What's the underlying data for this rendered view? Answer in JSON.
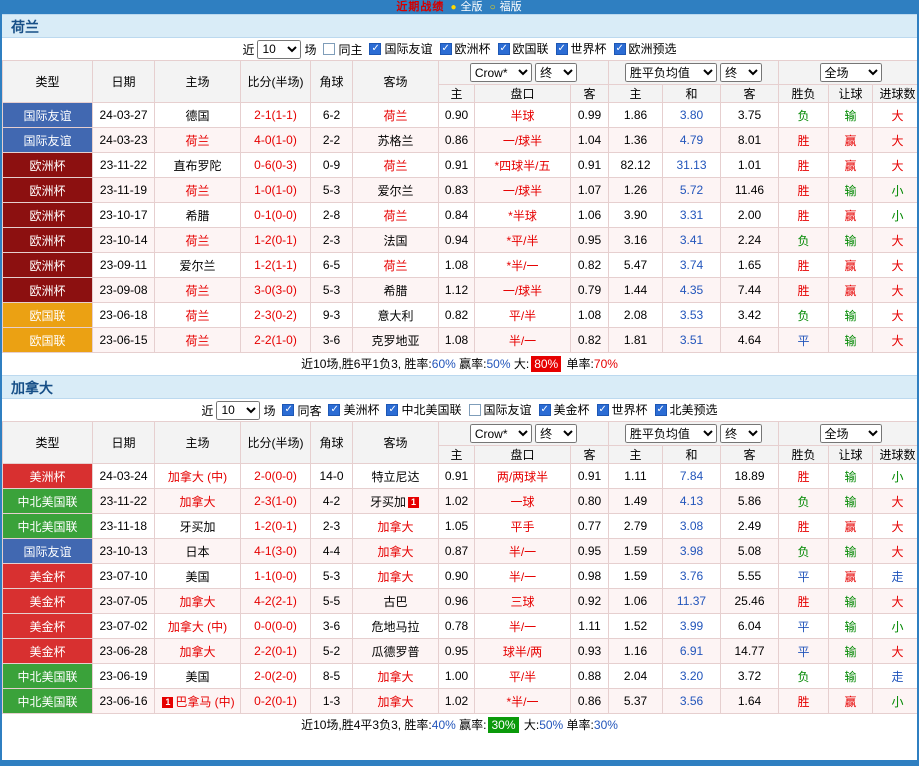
{
  "topbar": {
    "title": "近期战绩",
    "radio_on": "●",
    "tab_full": "全版",
    "radio_off": "○",
    "tab_fu": "福版"
  },
  "value_colors": {
    "胜": "#e60000",
    "平": "#2255bb",
    "负": "#008800",
    "赢": "#e60000",
    "输": "#008800",
    "大": "#e60000",
    "小": "#008800",
    "走": "#2255bb"
  },
  "league_colors": {
    "国际友谊": "#4168b1",
    "欧洲杯": "#8c1010",
    "欧国联": "#eba113",
    "美洲杯": "#d83030",
    "中北美国联": "#3aa23a",
    "美金杯": "#d83030"
  },
  "sections": [
    {
      "team": "荷兰",
      "filter": {
        "near": "近",
        "count": "10",
        "games": "场",
        "same": {
          "label": "同主",
          "checked": false
        },
        "leagues": [
          {
            "label": "国际友谊",
            "checked": true
          },
          {
            "label": "欧洲杯",
            "checked": true
          },
          {
            "label": "欧国联",
            "checked": true
          },
          {
            "label": "世界杯",
            "checked": true
          },
          {
            "label": "欧洲预选",
            "checked": true
          }
        ]
      },
      "columns": {
        "type": "类型",
        "date": "日期",
        "home": "主场",
        "score": "比分(半场)",
        "corner": "角球",
        "away": "客场",
        "odds_source": "Crow*",
        "final1": "终",
        "avg": "胜平负均值",
        "final2": "终",
        "scope": "全场",
        "sub_home": "主",
        "sub_handicap": "盘口",
        "sub_away": "客",
        "sub_avg_home": "主",
        "sub_avg_draw": "和",
        "sub_avg_away": "客",
        "sub_result": "胜负",
        "sub_let": "让球",
        "sub_goals": "进球数"
      },
      "rows": [
        {
          "league": "国际友谊",
          "date": "24-03-27",
          "home": "德国",
          "home_red": false,
          "score": "2-1(1-1)",
          "corner": "6-2",
          "away": "荷兰",
          "away_red": true,
          "odds_home": "0.90",
          "handicap": "半球",
          "odds_away": "0.99",
          "avg_home": "1.86",
          "avg_draw": "3.80",
          "avg_away": "3.75",
          "result": "负",
          "let_result": "输",
          "goals_result": "大"
        },
        {
          "league": "国际友谊",
          "date": "24-03-23",
          "home": "荷兰",
          "home_red": true,
          "score": "4-0(1-0)",
          "corner": "2-2",
          "away": "苏格兰",
          "away_red": false,
          "odds_home": "0.86",
          "handicap": "一/球半",
          "odds_away": "1.04",
          "avg_home": "1.36",
          "avg_draw": "4.79",
          "avg_away": "8.01",
          "result": "胜",
          "let_result": "赢",
          "goals_result": "大"
        },
        {
          "league": "欧洲杯",
          "date": "23-11-22",
          "home": "直布罗陀",
          "home_red": false,
          "score": "0-6(0-3)",
          "corner": "0-9",
          "away": "荷兰",
          "away_red": true,
          "odds_home": "0.91",
          "handicap": "*四球半/五",
          "odds_away": "0.91",
          "avg_home": "82.12",
          "avg_draw": "31.13",
          "avg_away": "1.01",
          "result": "胜",
          "let_result": "赢",
          "goals_result": "大"
        },
        {
          "league": "欧洲杯",
          "date": "23-11-19",
          "home": "荷兰",
          "home_red": true,
          "score": "1-0(1-0)",
          "corner": "5-3",
          "away": "爱尔兰",
          "away_red": false,
          "odds_home": "0.83",
          "handicap": "一/球半",
          "odds_away": "1.07",
          "avg_home": "1.26",
          "avg_draw": "5.72",
          "avg_away": "11.46",
          "result": "胜",
          "let_result": "输",
          "goals_result": "小"
        },
        {
          "league": "欧洲杯",
          "date": "23-10-17",
          "home": "希腊",
          "home_red": false,
          "score": "0-1(0-0)",
          "corner": "2-8",
          "away": "荷兰",
          "away_red": true,
          "odds_home": "0.84",
          "handicap": "*半球",
          "odds_away": "1.06",
          "avg_home": "3.90",
          "avg_draw": "3.31",
          "avg_away": "2.00",
          "result": "胜",
          "let_result": "赢",
          "goals_result": "小"
        },
        {
          "league": "欧洲杯",
          "date": "23-10-14",
          "home": "荷兰",
          "home_red": true,
          "score": "1-2(0-1)",
          "corner": "2-3",
          "away": "法国",
          "away_red": false,
          "odds_home": "0.94",
          "handicap": "*平/半",
          "odds_away": "0.95",
          "avg_home": "3.16",
          "avg_draw": "3.41",
          "avg_away": "2.24",
          "result": "负",
          "let_result": "输",
          "goals_result": "大"
        },
        {
          "league": "欧洲杯",
          "date": "23-09-11",
          "home": "爱尔兰",
          "home_red": false,
          "score": "1-2(1-1)",
          "corner": "6-5",
          "away": "荷兰",
          "away_red": true,
          "odds_home": "1.08",
          "handicap": "*半/一",
          "odds_away": "0.82",
          "avg_home": "5.47",
          "avg_draw": "3.74",
          "avg_away": "1.65",
          "result": "胜",
          "let_result": "赢",
          "goals_result": "大"
        },
        {
          "league": "欧洲杯",
          "date": "23-09-08",
          "home": "荷兰",
          "home_red": true,
          "score": "3-0(3-0)",
          "corner": "5-3",
          "away": "希腊",
          "away_red": false,
          "odds_home": "1.12",
          "handicap": "一/球半",
          "odds_away": "0.79",
          "avg_home": "1.44",
          "avg_draw": "4.35",
          "avg_away": "7.44",
          "result": "胜",
          "let_result": "赢",
          "goals_result": "大"
        },
        {
          "league": "欧国联",
          "date": "23-06-18",
          "home": "荷兰",
          "home_red": true,
          "score": "2-3(0-2)",
          "corner": "9-3",
          "away": "意大利",
          "away_red": false,
          "odds_home": "0.82",
          "handicap": "平/半",
          "odds_away": "1.08",
          "avg_home": "2.08",
          "avg_draw": "3.53",
          "avg_away": "3.42",
          "result": "负",
          "let_result": "输",
          "goals_result": "大"
        },
        {
          "league": "欧国联",
          "date": "23-06-15",
          "home": "荷兰",
          "home_red": true,
          "score": "2-2(1-0)",
          "corner": "3-6",
          "away": "克罗地亚",
          "away_red": false,
          "odds_home": "1.08",
          "handicap": "半/一",
          "odds_away": "0.82",
          "avg_home": "1.81",
          "avg_draw": "3.51",
          "avg_away": "4.64",
          "result": "平",
          "let_result": "输",
          "goals_result": "大"
        }
      ],
      "summary": [
        {
          "text": "近10场,胜6平1负3, 胜率:",
          "style": "plain"
        },
        {
          "text": "60%",
          "style": "blue"
        },
        {
          "text": " 赢率:",
          "style": "plain"
        },
        {
          "text": "50%",
          "style": "blue"
        },
        {
          "text": " 大:",
          "style": "plain"
        },
        {
          "text": "80%",
          "style": "red-badge"
        },
        {
          "text": " 单率:",
          "style": "plain"
        },
        {
          "text": "70%",
          "style": "red"
        }
      ]
    },
    {
      "team": "加拿大",
      "filter": {
        "near": "近",
        "count": "10",
        "games": "场",
        "same": {
          "label": "同客",
          "checked": true
        },
        "leagues": [
          {
            "label": "美洲杯",
            "checked": true
          },
          {
            "label": "中北美国联",
            "checked": true
          },
          {
            "label": "国际友谊",
            "checked": false
          },
          {
            "label": "美金杯",
            "checked": true
          },
          {
            "label": "世界杯",
            "checked": true
          },
          {
            "label": "北美预选",
            "checked": true
          }
        ]
      },
      "columns": {
        "type": "类型",
        "date": "日期",
        "home": "主场",
        "score": "比分(半场)",
        "corner": "角球",
        "away": "客场",
        "odds_source": "Crow*",
        "final1": "终",
        "avg": "胜平负均值",
        "final2": "终",
        "scope": "全场",
        "sub_home": "主",
        "sub_handicap": "盘口",
        "sub_away": "客",
        "sub_avg_home": "主",
        "sub_avg_draw": "和",
        "sub_avg_away": "客",
        "sub_result": "胜负",
        "sub_let": "让球",
        "sub_goals": "进球数"
      },
      "rows": [
        {
          "league": "美洲杯",
          "date": "24-03-24",
          "home": "加拿大 (中)",
          "home_red": true,
          "score": "2-0(0-0)",
          "corner": "14-0",
          "away": "特立尼达",
          "away_red": false,
          "odds_home": "0.91",
          "handicap": "两/两球半",
          "odds_away": "0.91",
          "avg_home": "1.11",
          "avg_draw": "7.84",
          "avg_away": "18.89",
          "result": "胜",
          "let_result": "输",
          "goals_result": "小"
        },
        {
          "league": "中北美国联",
          "date": "23-11-22",
          "home": "加拿大",
          "home_red": true,
          "score": "2-3(1-0)",
          "corner": "4-2",
          "away": "牙买加",
          "away_red": false,
          "away_badge": "1",
          "odds_home": "1.02",
          "handicap": "一球",
          "odds_away": "0.80",
          "avg_home": "1.49",
          "avg_draw": "4.13",
          "avg_away": "5.86",
          "result": "负",
          "let_result": "输",
          "goals_result": "大"
        },
        {
          "league": "中北美国联",
          "date": "23-11-18",
          "home": "牙买加",
          "home_red": false,
          "score": "1-2(0-1)",
          "corner": "2-3",
          "away": "加拿大",
          "away_red": true,
          "odds_home": "1.05",
          "handicap": "平手",
          "odds_away": "0.77",
          "avg_home": "2.79",
          "avg_draw": "3.08",
          "avg_away": "2.49",
          "result": "胜",
          "let_result": "赢",
          "goals_result": "大"
        },
        {
          "league": "国际友谊",
          "date": "23-10-13",
          "home": "日本",
          "home_red": false,
          "score": "4-1(3-0)",
          "corner": "4-4",
          "away": "加拿大",
          "away_red": true,
          "odds_home": "0.87",
          "handicap": "半/一",
          "odds_away": "0.95",
          "avg_home": "1.59",
          "avg_draw": "3.98",
          "avg_away": "5.08",
          "result": "负",
          "let_result": "输",
          "goals_result": "大"
        },
        {
          "league": "美金杯",
          "date": "23-07-10",
          "home": "美国",
          "home_red": false,
          "score": "1-1(0-0)",
          "corner": "5-3",
          "away": "加拿大",
          "away_red": true,
          "odds_home": "0.90",
          "handicap": "半/一",
          "odds_away": "0.98",
          "avg_home": "1.59",
          "avg_draw": "3.76",
          "avg_away": "5.55",
          "result": "平",
          "let_result": "赢",
          "goals_result": "走"
        },
        {
          "league": "美金杯",
          "date": "23-07-05",
          "home": "加拿大",
          "home_red": true,
          "score": "4-2(2-1)",
          "corner": "5-5",
          "away": "古巴",
          "away_red": false,
          "odds_home": "0.96",
          "handicap": "三球",
          "odds_away": "0.92",
          "avg_home": "1.06",
          "avg_draw": "11.37",
          "avg_away": "25.46",
          "result": "胜",
          "let_result": "输",
          "goals_result": "大"
        },
        {
          "league": "美金杯",
          "date": "23-07-02",
          "home": "加拿大 (中)",
          "home_red": true,
          "score": "0-0(0-0)",
          "corner": "3-6",
          "away": "危地马拉",
          "away_red": false,
          "odds_home": "0.78",
          "handicap": "半/一",
          "odds_away": "1.11",
          "avg_home": "1.52",
          "avg_draw": "3.99",
          "avg_away": "6.04",
          "result": "平",
          "let_result": "输",
          "goals_result": "小"
        },
        {
          "league": "美金杯",
          "date": "23-06-28",
          "home": "加拿大",
          "home_red": true,
          "score": "2-2(0-1)",
          "corner": "5-2",
          "away": "瓜德罗普",
          "away_red": false,
          "odds_home": "0.95",
          "handicap": "球半/两",
          "odds_away": "0.93",
          "avg_home": "1.16",
          "avg_draw": "6.91",
          "avg_away": "14.77",
          "result": "平",
          "let_result": "输",
          "goals_result": "大"
        },
        {
          "league": "中北美国联",
          "date": "23-06-19",
          "home": "美国",
          "home_red": false,
          "score": "2-0(2-0)",
          "corner": "8-5",
          "away": "加拿大",
          "away_red": true,
          "odds_home": "1.00",
          "handicap": "平/半",
          "odds_away": "0.88",
          "avg_home": "2.04",
          "avg_draw": "3.20",
          "avg_away": "3.72",
          "result": "负",
          "let_result": "输",
          "goals_result": "走"
        },
        {
          "league": "中北美国联",
          "date": "23-06-16",
          "home": "巴拿马 (中)",
          "home_red": true,
          "home_badge": "1",
          "score": "0-2(0-1)",
          "corner": "1-3",
          "away": "加拿大",
          "away_red": true,
          "odds_home": "1.02",
          "handicap": "*半/一",
          "odds_away": "0.86",
          "avg_home": "5.37",
          "avg_draw": "3.56",
          "avg_away": "1.64",
          "result": "胜",
          "let_result": "赢",
          "goals_result": "小"
        }
      ],
      "summary": [
        {
          "text": "近10场,胜4平3负3, 胜率:",
          "style": "plain"
        },
        {
          "text": "40%",
          "style": "blue"
        },
        {
          "text": " 赢率:",
          "style": "plain"
        },
        {
          "text": "30%",
          "style": "green-badge"
        },
        {
          "text": " 大:",
          "style": "plain"
        },
        {
          "text": "50%",
          "style": "blue"
        },
        {
          "text": " 单率:",
          "style": "plain"
        },
        {
          "text": "30%",
          "style": "blue"
        }
      ]
    }
  ]
}
